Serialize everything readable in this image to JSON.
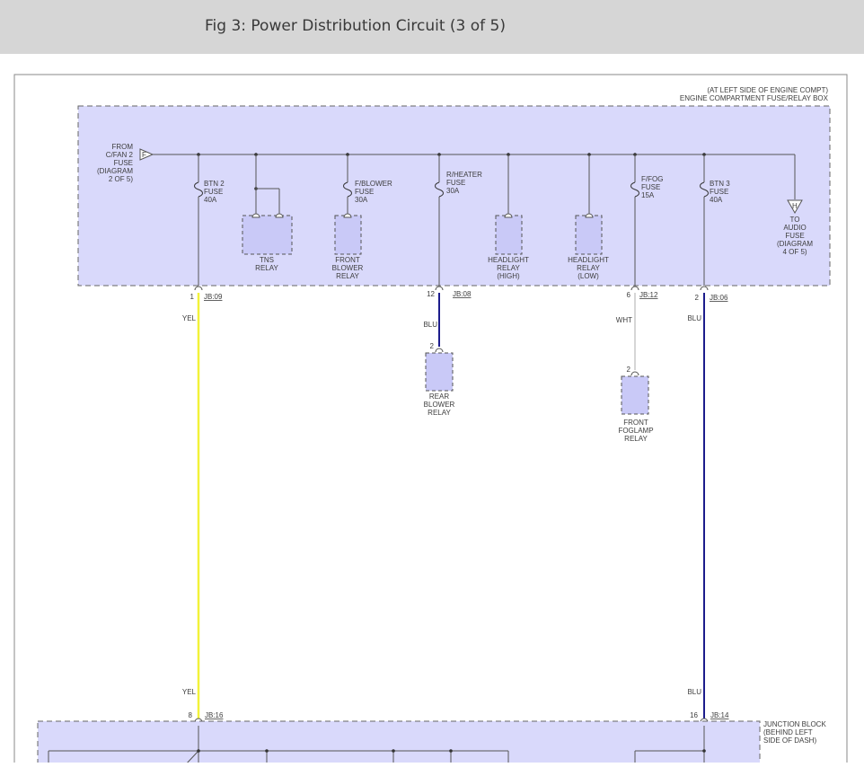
{
  "header": {
    "title": "Fig 3: Power Distribution Circuit (3 of 5)"
  },
  "diagram": {
    "box_note_1": "(AT LEFT SIDE OF ENGINE COMPT)",
    "box_note_2": "ENGINE COMPARTMENT FUSE/RELAY BOX",
    "from_connector": "F",
    "from_label": [
      "FROM",
      "C/FAN 2",
      "FUSE",
      "(DIAGRAM",
      "2 OF 5)"
    ],
    "to_connector": "H",
    "to_label": [
      "TO",
      "AUDIO",
      "FUSE",
      "(DIAGRAM",
      "4 OF 5)"
    ],
    "fuses": [
      {
        "lines": [
          "BTN 2",
          "FUSE",
          "40A"
        ]
      },
      {
        "lines": [
          "F/BLOWER",
          "FUSE",
          "30A"
        ]
      },
      {
        "lines": [
          "R/HEATER",
          "FUSE",
          "30A"
        ]
      },
      {
        "lines": [
          "F/FOG",
          "FUSE",
          "15A"
        ]
      },
      {
        "lines": [
          "BTN 3",
          "FUSE",
          "40A"
        ]
      }
    ],
    "relays": [
      {
        "lines": [
          "TNS",
          "RELAY"
        ]
      },
      {
        "lines": [
          "FRONT",
          "BLOWER",
          "RELAY"
        ]
      },
      {
        "lines": [
          "HEADLIGHT",
          "RELAY",
          "(HIGH)"
        ]
      },
      {
        "lines": [
          "HEADLIGHT",
          "RELAY",
          "(LOW)"
        ]
      }
    ],
    "outputs": [
      {
        "pin": "1",
        "jb": "JB:09",
        "wire": "YEL"
      },
      {
        "pin": "12",
        "jb": "JB:08",
        "wire": "BLU"
      },
      {
        "pin": "6",
        "jb": "JB:12",
        "wire": "WHT"
      },
      {
        "pin": "2",
        "jb": "JB:06",
        "wire": "BLU"
      }
    ],
    "rear_blower": {
      "pin": "2",
      "lines": [
        "REAR",
        "BLOWER",
        "RELAY"
      ]
    },
    "front_foglamp": {
      "pin": "2",
      "lines": [
        "FRONT",
        "FOGLAMP",
        "RELAY"
      ]
    },
    "bottom_wires": [
      {
        "wire": "YEL",
        "pin": "8",
        "jb": "JB:16"
      },
      {
        "wire": "BLU",
        "pin": "16",
        "jb": "JB:14"
      }
    ],
    "junction_block": [
      "JUNCTION BLOCK",
      "(BEHIND LEFT",
      "SIDE OF DASH)"
    ],
    "colors": {
      "box_fill": "#d9d9fb",
      "yellow_wire": "#f2f23a",
      "blue_wire": "#1c1c8c",
      "white_wire": "#c8c8c8",
      "line": "#555555"
    }
  }
}
